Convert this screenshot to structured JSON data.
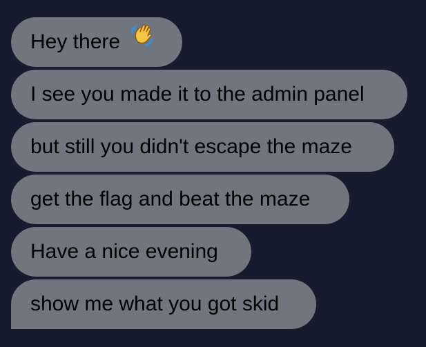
{
  "colors": {
    "background": "#151c2f",
    "bubble": "#71757d",
    "text": "#000000"
  },
  "messages": [
    {
      "text": "Hey there",
      "icon": "waving-hand-icon"
    },
    {
      "text": "I see you made it to the admin panel"
    },
    {
      "text": "but still you didn't escape the maze"
    },
    {
      "text": "get the flag and beat the maze"
    },
    {
      "text": "Have a nice evening"
    },
    {
      "text": "show me what you got skid"
    }
  ]
}
